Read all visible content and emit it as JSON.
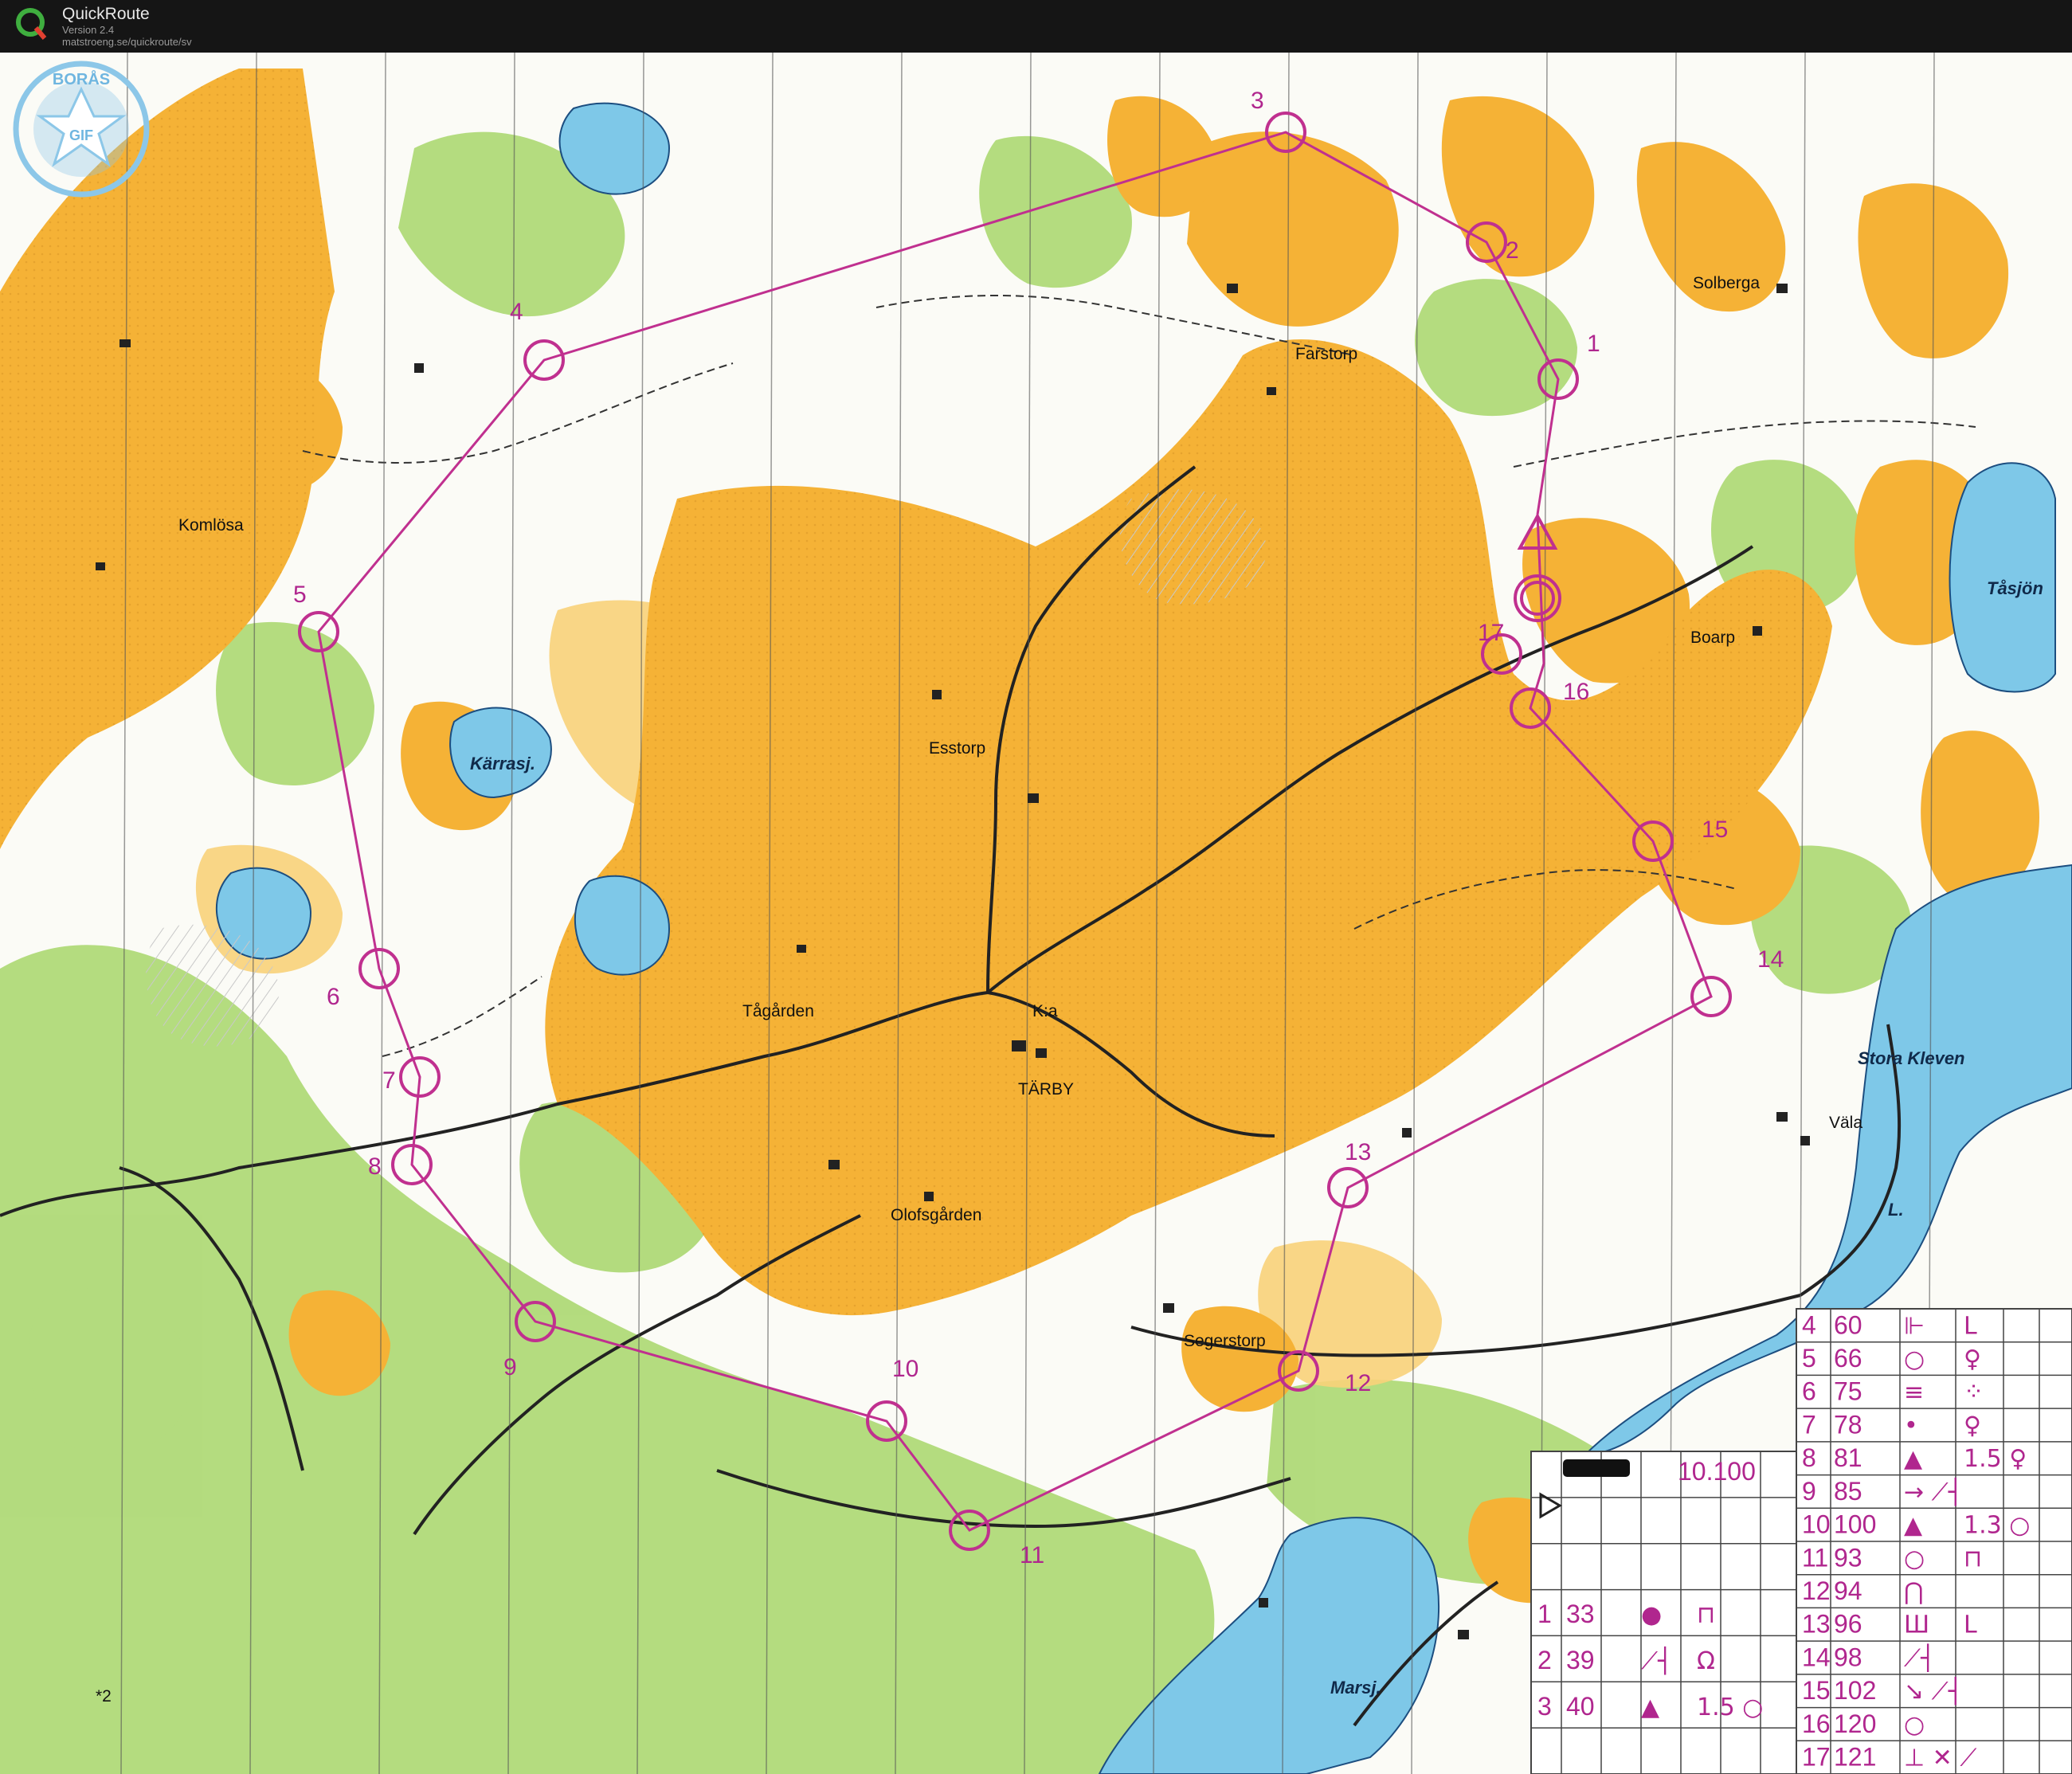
{
  "app": {
    "name": "QuickRoute",
    "version": "Version 2.4",
    "url": "matstroeng.se/quickroute/sv"
  },
  "colors": {
    "field": "#f5b236",
    "field_light": "#f8d27a",
    "forest_green": "#a7d66a",
    "water": "#7ec8e8",
    "course": "#c0308f",
    "paper": "#fbfbf6"
  },
  "map": {
    "club_logo": {
      "top": "BORÅS",
      "center": "GIF"
    },
    "places": {
      "komlosa": "Komlösa",
      "solberga": "Solberga",
      "farstorp": "Farstorp",
      "tasjon": "Tåsjön",
      "boarp": "Boarp",
      "karrasj": "Kärrasj.",
      "esstorp": "Esstorp",
      "tagarden": "Tågården",
      "ka": "K:a",
      "tarby": "TÄRBY",
      "stora_kleven": "Stora Kleven",
      "vala": "Väla",
      "l": "L.",
      "olofsgarden": "Olofsgården",
      "segerstorp": "Segerstorp",
      "marsj": "Marsj."
    },
    "corner_mark": "*2",
    "scale_text": "10.100"
  },
  "course": {
    "controls": [
      {
        "label": "1"
      },
      {
        "label": "2"
      },
      {
        "label": "3"
      },
      {
        "label": "4"
      },
      {
        "label": "5"
      },
      {
        "label": "6"
      },
      {
        "label": "7"
      },
      {
        "label": "8"
      },
      {
        "label": "9"
      },
      {
        "label": "10"
      },
      {
        "label": "11"
      },
      {
        "label": "12"
      },
      {
        "label": "13"
      },
      {
        "label": "14"
      },
      {
        "label": "15"
      },
      {
        "label": "16"
      },
      {
        "label": "17"
      }
    ]
  },
  "description_sheet": {
    "left": [
      {
        "n": "1",
        "code": "33",
        "sym": "●",
        "extra": "⊓"
      },
      {
        "n": "2",
        "code": "39",
        "sym": "⟋┤",
        "extra": "Ω"
      },
      {
        "n": "3",
        "code": "40",
        "sym": "▲",
        "extra": "1.5 ○"
      }
    ],
    "right": [
      {
        "n": "4",
        "code": "60",
        "sym": "⊩",
        "extra": "L"
      },
      {
        "n": "5",
        "code": "66",
        "sym": "○",
        "extra": "♀"
      },
      {
        "n": "6",
        "code": "75",
        "sym": "≡",
        "extra": "⁘"
      },
      {
        "n": "7",
        "code": "78",
        "sym": "•",
        "extra": "♀"
      },
      {
        "n": "8",
        "code": "81",
        "sym": "▲",
        "extra": "1.5 ♀"
      },
      {
        "n": "9",
        "code": "85",
        "sym": "→ ⟋┤",
        "extra": ""
      },
      {
        "n": "10",
        "code": "100",
        "sym": "▲",
        "extra": "1.3 ○"
      },
      {
        "n": "11",
        "code": "93",
        "sym": "○",
        "extra": "⊓"
      },
      {
        "n": "12",
        "code": "94",
        "sym": "⋂",
        "extra": ""
      },
      {
        "n": "13",
        "code": "96",
        "sym": "Ш",
        "extra": "L"
      },
      {
        "n": "14",
        "code": "98",
        "sym": "⟋┤",
        "extra": ""
      },
      {
        "n": "15",
        "code": "102",
        "sym": "↘ ⟋┤",
        "extra": ""
      },
      {
        "n": "16",
        "code": "120",
        "sym": "○",
        "extra": ""
      },
      {
        "n": "17",
        "code": "121",
        "sym": "⊥ ✕ ⟋",
        "extra": ""
      }
    ]
  }
}
